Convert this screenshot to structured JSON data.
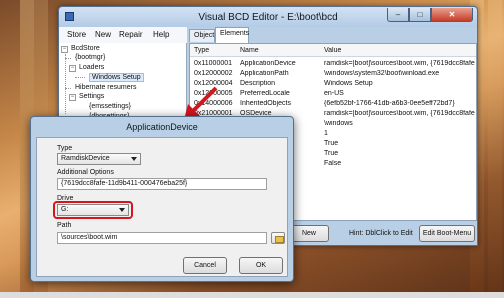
{
  "main_window": {
    "title": "Visual BCD Editor - E:\\boot\\bcd",
    "minimize": "–",
    "maximize": "□",
    "close": "✕",
    "app_icon": "BCD"
  },
  "menu": [
    "Store",
    "New",
    "Repair",
    "Help"
  ],
  "tree": {
    "root": "BcdStore",
    "bootmgr": "{bootmgr}",
    "loaders": "Loaders",
    "windows_setup": "Windows Setup",
    "hibernate": "Hibernate resumers",
    "settings": "Settings",
    "emssettings": "{emssettings}",
    "dbgsettings": "{dbgsettings}"
  },
  "tabs": [
    "Object",
    "Elements"
  ],
  "grid": {
    "headers": [
      "Type",
      "Name",
      "Value"
    ],
    "rows": [
      [
        "0x11000001",
        "ApplicationDevice",
        "ramdisk=[boot]\\sources\\boot.wim, {7619dcc8fafe"
      ],
      [
        "0x12000002",
        "ApplicationPath",
        "\\windows\\system32\\boot\\winload.exe"
      ],
      [
        "0x12000004",
        "Description",
        "Windows Setup"
      ],
      [
        "0x12000005",
        "PreferredLocale",
        "en-US"
      ],
      [
        "0x14000006",
        "InheritedObjects",
        "{6efb52bf-1766-41db-a6b3-0ee5eff72bd7}"
      ],
      [
        "0x21000001",
        "OSDevice",
        "ramdisk=[boot]\\sources\\boot.wim, {7619dcc8fafe"
      ],
      [
        "",
        "",
        "\\windows"
      ],
      [
        "",
        "",
        "1"
      ],
      [
        "",
        "",
        "True"
      ],
      [
        "",
        "",
        "True"
      ],
      [
        "",
        "",
        "False"
      ]
    ]
  },
  "bottom": {
    "new_label": "New",
    "hint": "Hint: DblClick to Edit",
    "edit_boot_menu": "Edit Boot-Menu"
  },
  "dialog": {
    "title": "ApplicationDevice",
    "type_label": "Type",
    "type_value": "RamdiskDevice",
    "options_label": "Additional Options",
    "options_value": "{7619dcc8fafe-11d9b411-000476eba25f}",
    "drive_label": "Drive",
    "drive_value": "G:",
    "path_label": "Path",
    "path_value": "\\sources\\boot.wim",
    "cancel": "Cancel",
    "ok": "OK"
  },
  "colors": {
    "highlight": "#d8141c",
    "arrow": "#d8141c"
  }
}
